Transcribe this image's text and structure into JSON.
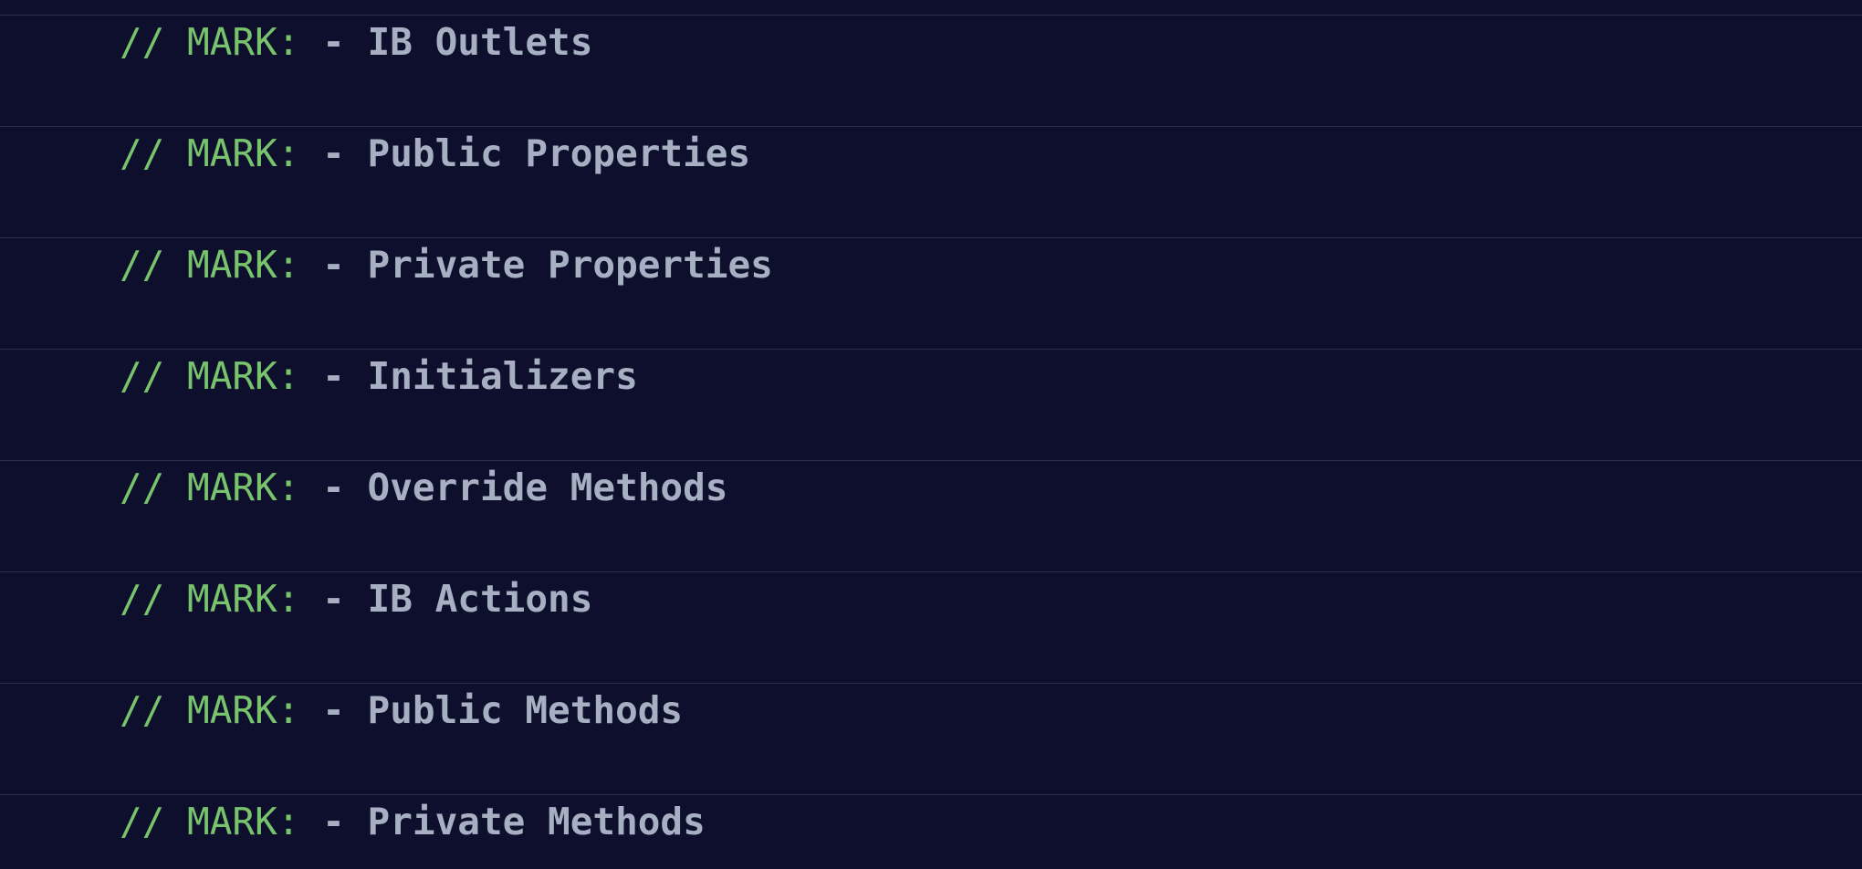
{
  "theme": {
    "background": "#0e0f2c",
    "separator": "#2c2e4d",
    "comment_color": "#78c46d",
    "mark_text_color": "#a7b0c3"
  },
  "lines": [
    {
      "prefix": "// MARK: ",
      "title": "- IB Outlets"
    },
    {
      "prefix": "// MARK: ",
      "title": "- Public Properties"
    },
    {
      "prefix": "// MARK: ",
      "title": "- Private Properties"
    },
    {
      "prefix": "// MARK: ",
      "title": "- Initializers"
    },
    {
      "prefix": "// MARK: ",
      "title": "- Override Methods"
    },
    {
      "prefix": "// MARK: ",
      "title": "- IB Actions"
    },
    {
      "prefix": "// MARK: ",
      "title": "- Public Methods"
    },
    {
      "prefix": "// MARK: ",
      "title": "- Private Methods"
    }
  ]
}
